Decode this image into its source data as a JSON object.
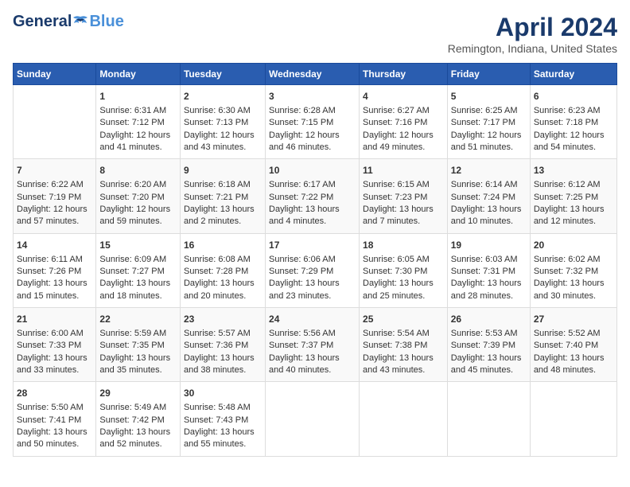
{
  "header": {
    "logo_general": "General",
    "logo_blue": "Blue",
    "title": "April 2024",
    "subtitle": "Remington, Indiana, United States"
  },
  "calendar": {
    "days_of_week": [
      "Sunday",
      "Monday",
      "Tuesday",
      "Wednesday",
      "Thursday",
      "Friday",
      "Saturday"
    ],
    "weeks": [
      [
        {
          "date": "",
          "sunrise": "",
          "sunset": "",
          "daylight": ""
        },
        {
          "date": "1",
          "sunrise": "Sunrise: 6:31 AM",
          "sunset": "Sunset: 7:12 PM",
          "daylight": "Daylight: 12 hours and 41 minutes."
        },
        {
          "date": "2",
          "sunrise": "Sunrise: 6:30 AM",
          "sunset": "Sunset: 7:13 PM",
          "daylight": "Daylight: 12 hours and 43 minutes."
        },
        {
          "date": "3",
          "sunrise": "Sunrise: 6:28 AM",
          "sunset": "Sunset: 7:15 PM",
          "daylight": "Daylight: 12 hours and 46 minutes."
        },
        {
          "date": "4",
          "sunrise": "Sunrise: 6:27 AM",
          "sunset": "Sunset: 7:16 PM",
          "daylight": "Daylight: 12 hours and 49 minutes."
        },
        {
          "date": "5",
          "sunrise": "Sunrise: 6:25 AM",
          "sunset": "Sunset: 7:17 PM",
          "daylight": "Daylight: 12 hours and 51 minutes."
        },
        {
          "date": "6",
          "sunrise": "Sunrise: 6:23 AM",
          "sunset": "Sunset: 7:18 PM",
          "daylight": "Daylight: 12 hours and 54 minutes."
        }
      ],
      [
        {
          "date": "7",
          "sunrise": "Sunrise: 6:22 AM",
          "sunset": "Sunset: 7:19 PM",
          "daylight": "Daylight: 12 hours and 57 minutes."
        },
        {
          "date": "8",
          "sunrise": "Sunrise: 6:20 AM",
          "sunset": "Sunset: 7:20 PM",
          "daylight": "Daylight: 12 hours and 59 minutes."
        },
        {
          "date": "9",
          "sunrise": "Sunrise: 6:18 AM",
          "sunset": "Sunset: 7:21 PM",
          "daylight": "Daylight: 13 hours and 2 minutes."
        },
        {
          "date": "10",
          "sunrise": "Sunrise: 6:17 AM",
          "sunset": "Sunset: 7:22 PM",
          "daylight": "Daylight: 13 hours and 4 minutes."
        },
        {
          "date": "11",
          "sunrise": "Sunrise: 6:15 AM",
          "sunset": "Sunset: 7:23 PM",
          "daylight": "Daylight: 13 hours and 7 minutes."
        },
        {
          "date": "12",
          "sunrise": "Sunrise: 6:14 AM",
          "sunset": "Sunset: 7:24 PM",
          "daylight": "Daylight: 13 hours and 10 minutes."
        },
        {
          "date": "13",
          "sunrise": "Sunrise: 6:12 AM",
          "sunset": "Sunset: 7:25 PM",
          "daylight": "Daylight: 13 hours and 12 minutes."
        }
      ],
      [
        {
          "date": "14",
          "sunrise": "Sunrise: 6:11 AM",
          "sunset": "Sunset: 7:26 PM",
          "daylight": "Daylight: 13 hours and 15 minutes."
        },
        {
          "date": "15",
          "sunrise": "Sunrise: 6:09 AM",
          "sunset": "Sunset: 7:27 PM",
          "daylight": "Daylight: 13 hours and 18 minutes."
        },
        {
          "date": "16",
          "sunrise": "Sunrise: 6:08 AM",
          "sunset": "Sunset: 7:28 PM",
          "daylight": "Daylight: 13 hours and 20 minutes."
        },
        {
          "date": "17",
          "sunrise": "Sunrise: 6:06 AM",
          "sunset": "Sunset: 7:29 PM",
          "daylight": "Daylight: 13 hours and 23 minutes."
        },
        {
          "date": "18",
          "sunrise": "Sunrise: 6:05 AM",
          "sunset": "Sunset: 7:30 PM",
          "daylight": "Daylight: 13 hours and 25 minutes."
        },
        {
          "date": "19",
          "sunrise": "Sunrise: 6:03 AM",
          "sunset": "Sunset: 7:31 PM",
          "daylight": "Daylight: 13 hours and 28 minutes."
        },
        {
          "date": "20",
          "sunrise": "Sunrise: 6:02 AM",
          "sunset": "Sunset: 7:32 PM",
          "daylight": "Daylight: 13 hours and 30 minutes."
        }
      ],
      [
        {
          "date": "21",
          "sunrise": "Sunrise: 6:00 AM",
          "sunset": "Sunset: 7:33 PM",
          "daylight": "Daylight: 13 hours and 33 minutes."
        },
        {
          "date": "22",
          "sunrise": "Sunrise: 5:59 AM",
          "sunset": "Sunset: 7:35 PM",
          "daylight": "Daylight: 13 hours and 35 minutes."
        },
        {
          "date": "23",
          "sunrise": "Sunrise: 5:57 AM",
          "sunset": "Sunset: 7:36 PM",
          "daylight": "Daylight: 13 hours and 38 minutes."
        },
        {
          "date": "24",
          "sunrise": "Sunrise: 5:56 AM",
          "sunset": "Sunset: 7:37 PM",
          "daylight": "Daylight: 13 hours and 40 minutes."
        },
        {
          "date": "25",
          "sunrise": "Sunrise: 5:54 AM",
          "sunset": "Sunset: 7:38 PM",
          "daylight": "Daylight: 13 hours and 43 minutes."
        },
        {
          "date": "26",
          "sunrise": "Sunrise: 5:53 AM",
          "sunset": "Sunset: 7:39 PM",
          "daylight": "Daylight: 13 hours and 45 minutes."
        },
        {
          "date": "27",
          "sunrise": "Sunrise: 5:52 AM",
          "sunset": "Sunset: 7:40 PM",
          "daylight": "Daylight: 13 hours and 48 minutes."
        }
      ],
      [
        {
          "date": "28",
          "sunrise": "Sunrise: 5:50 AM",
          "sunset": "Sunset: 7:41 PM",
          "daylight": "Daylight: 13 hours and 50 minutes."
        },
        {
          "date": "29",
          "sunrise": "Sunrise: 5:49 AM",
          "sunset": "Sunset: 7:42 PM",
          "daylight": "Daylight: 13 hours and 52 minutes."
        },
        {
          "date": "30",
          "sunrise": "Sunrise: 5:48 AM",
          "sunset": "Sunset: 7:43 PM",
          "daylight": "Daylight: 13 hours and 55 minutes."
        },
        {
          "date": "",
          "sunrise": "",
          "sunset": "",
          "daylight": ""
        },
        {
          "date": "",
          "sunrise": "",
          "sunset": "",
          "daylight": ""
        },
        {
          "date": "",
          "sunrise": "",
          "sunset": "",
          "daylight": ""
        },
        {
          "date": "",
          "sunrise": "",
          "sunset": "",
          "daylight": ""
        }
      ]
    ]
  }
}
